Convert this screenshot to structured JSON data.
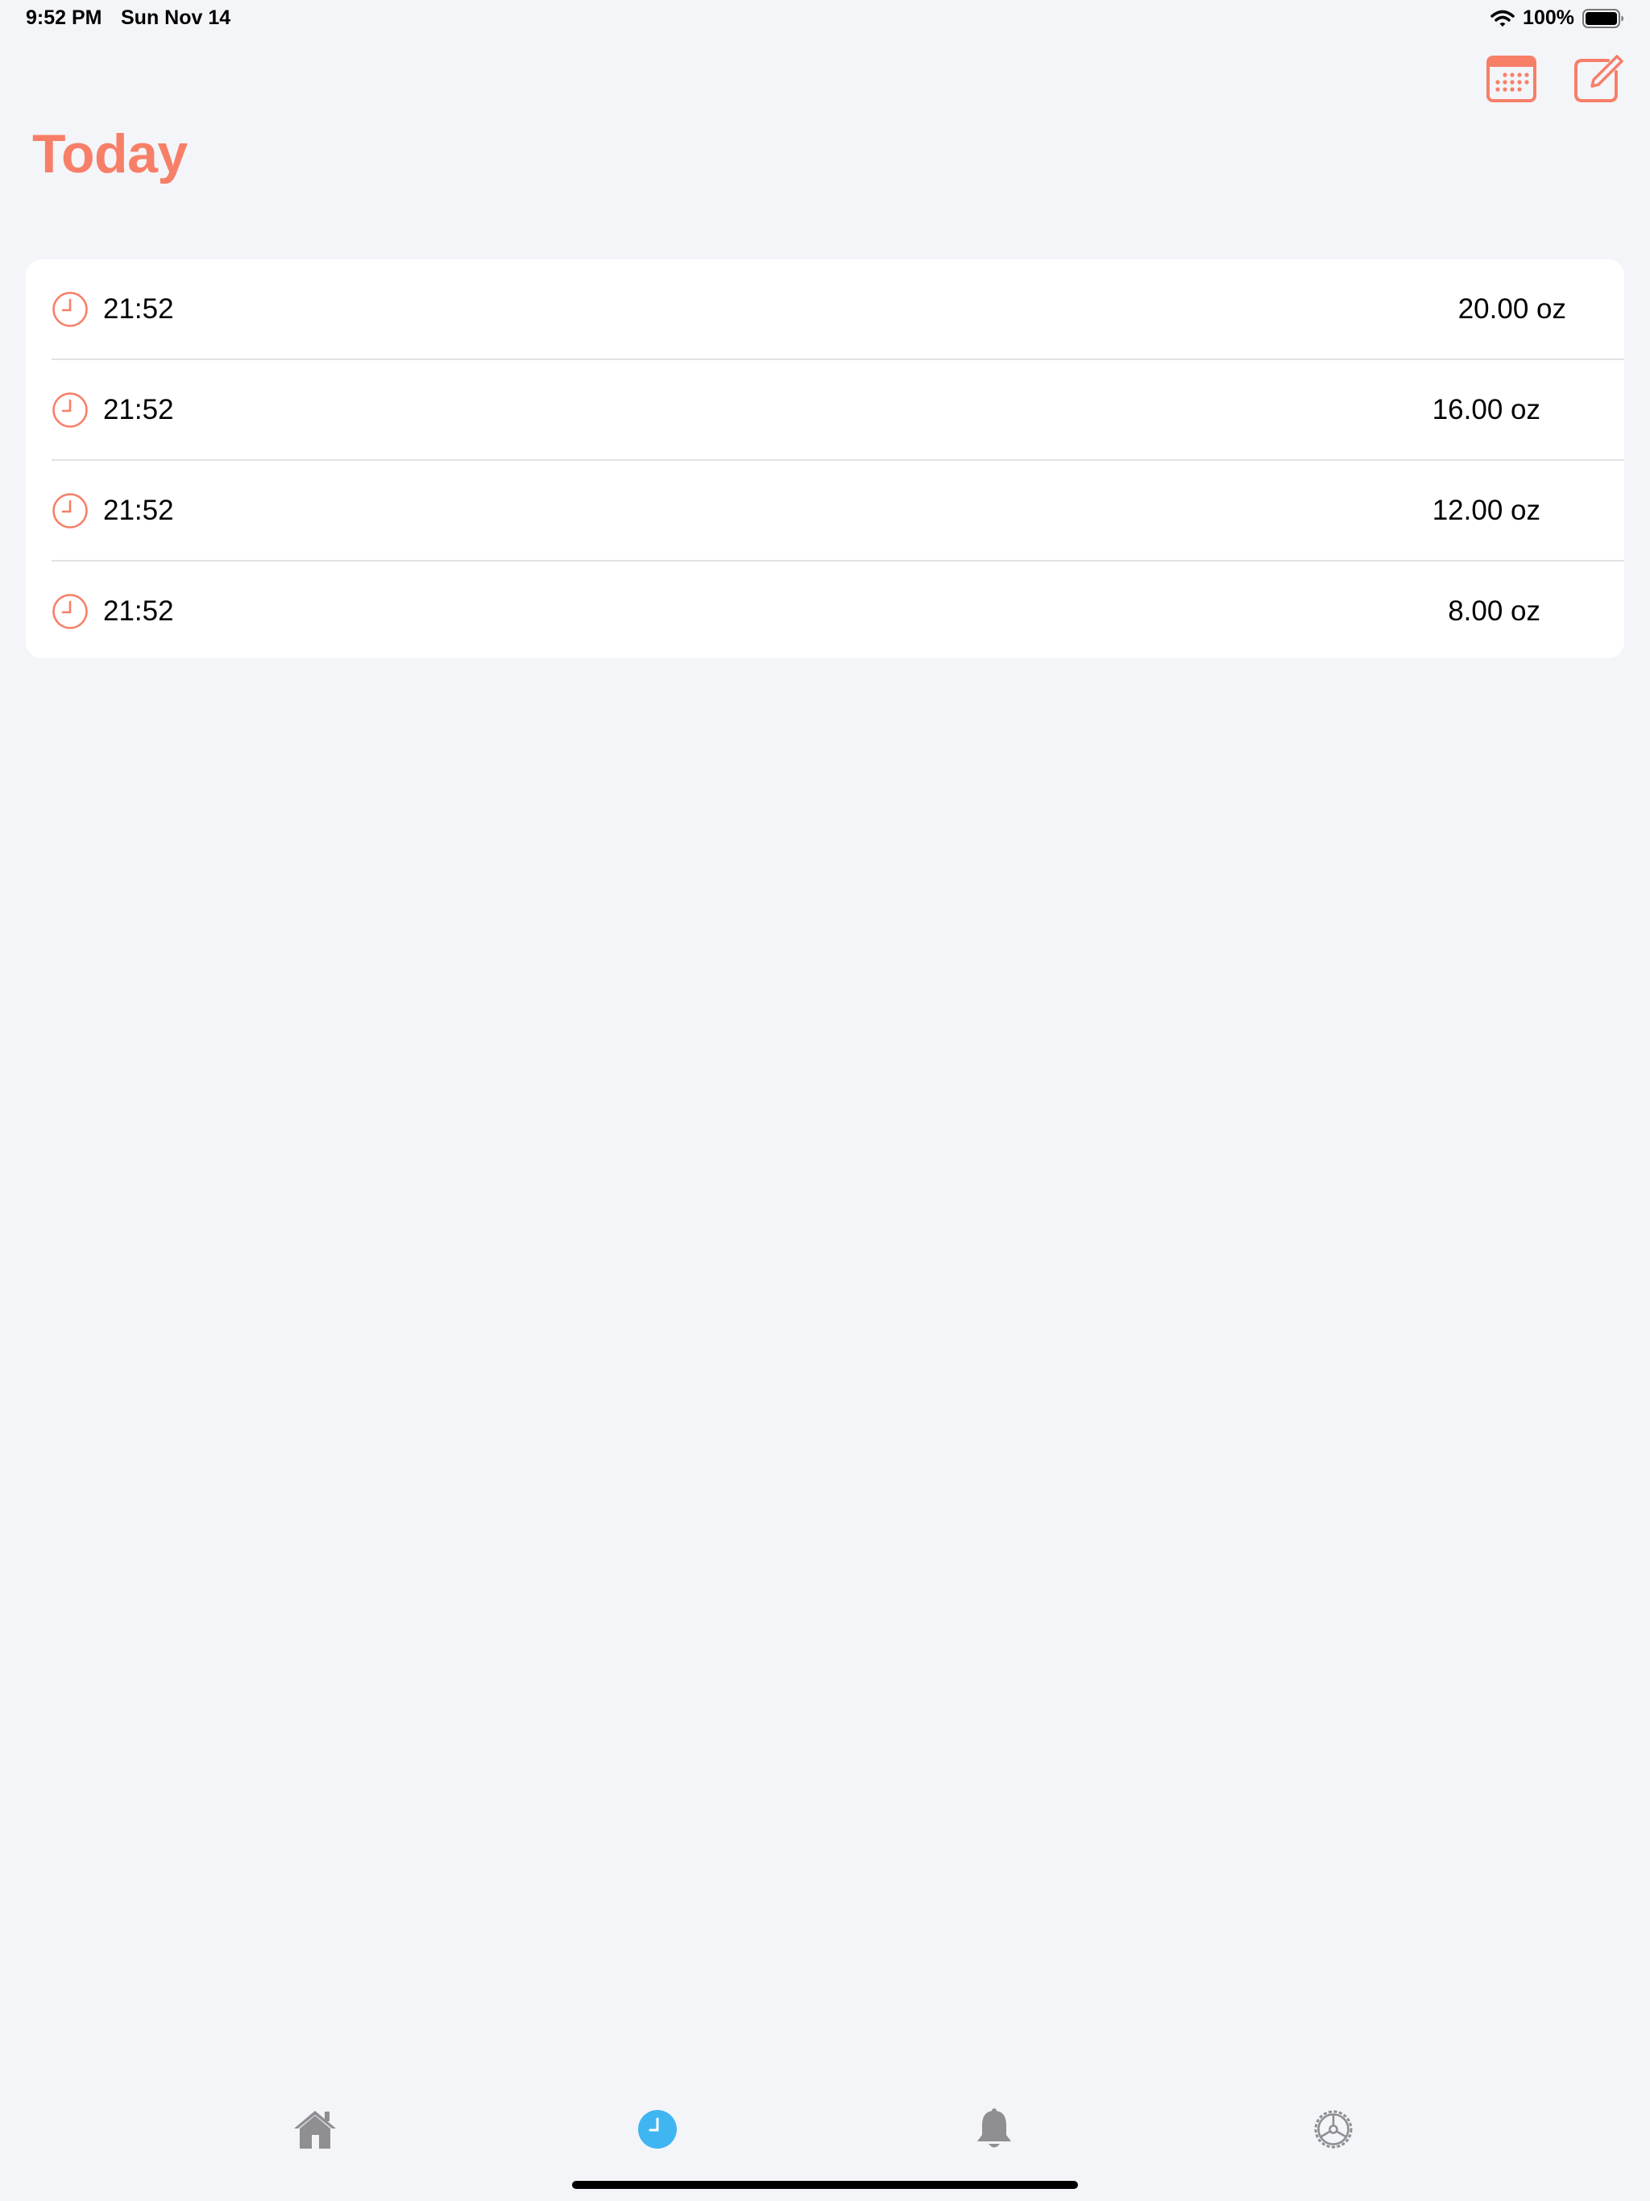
{
  "status_bar": {
    "time": "9:52 PM",
    "date": "Sun Nov 14",
    "battery_percent": "100%",
    "battery_level": 1.0
  },
  "header": {
    "title": "Today",
    "actions": [
      "calendar-icon",
      "compose-icon"
    ]
  },
  "entries": [
    {
      "time": "21:52",
      "amount": "20.00 oz"
    },
    {
      "time": "21:52",
      "amount": "16.00 oz"
    },
    {
      "time": "21:52",
      "amount": "12.00 oz"
    },
    {
      "time": "21:52",
      "amount": "8.00 oz"
    }
  ],
  "tabs": [
    {
      "icon": "home-icon",
      "selected": false
    },
    {
      "icon": "clock-icon",
      "selected": true
    },
    {
      "icon": "bell-icon",
      "selected": false
    },
    {
      "icon": "settings-gear-icon",
      "selected": false
    }
  ],
  "colors": {
    "accent": "#f77f68",
    "tab_selected": "#3fb6f1",
    "tab_inactive": "#8e8e93",
    "background": "#f4f5f9"
  }
}
